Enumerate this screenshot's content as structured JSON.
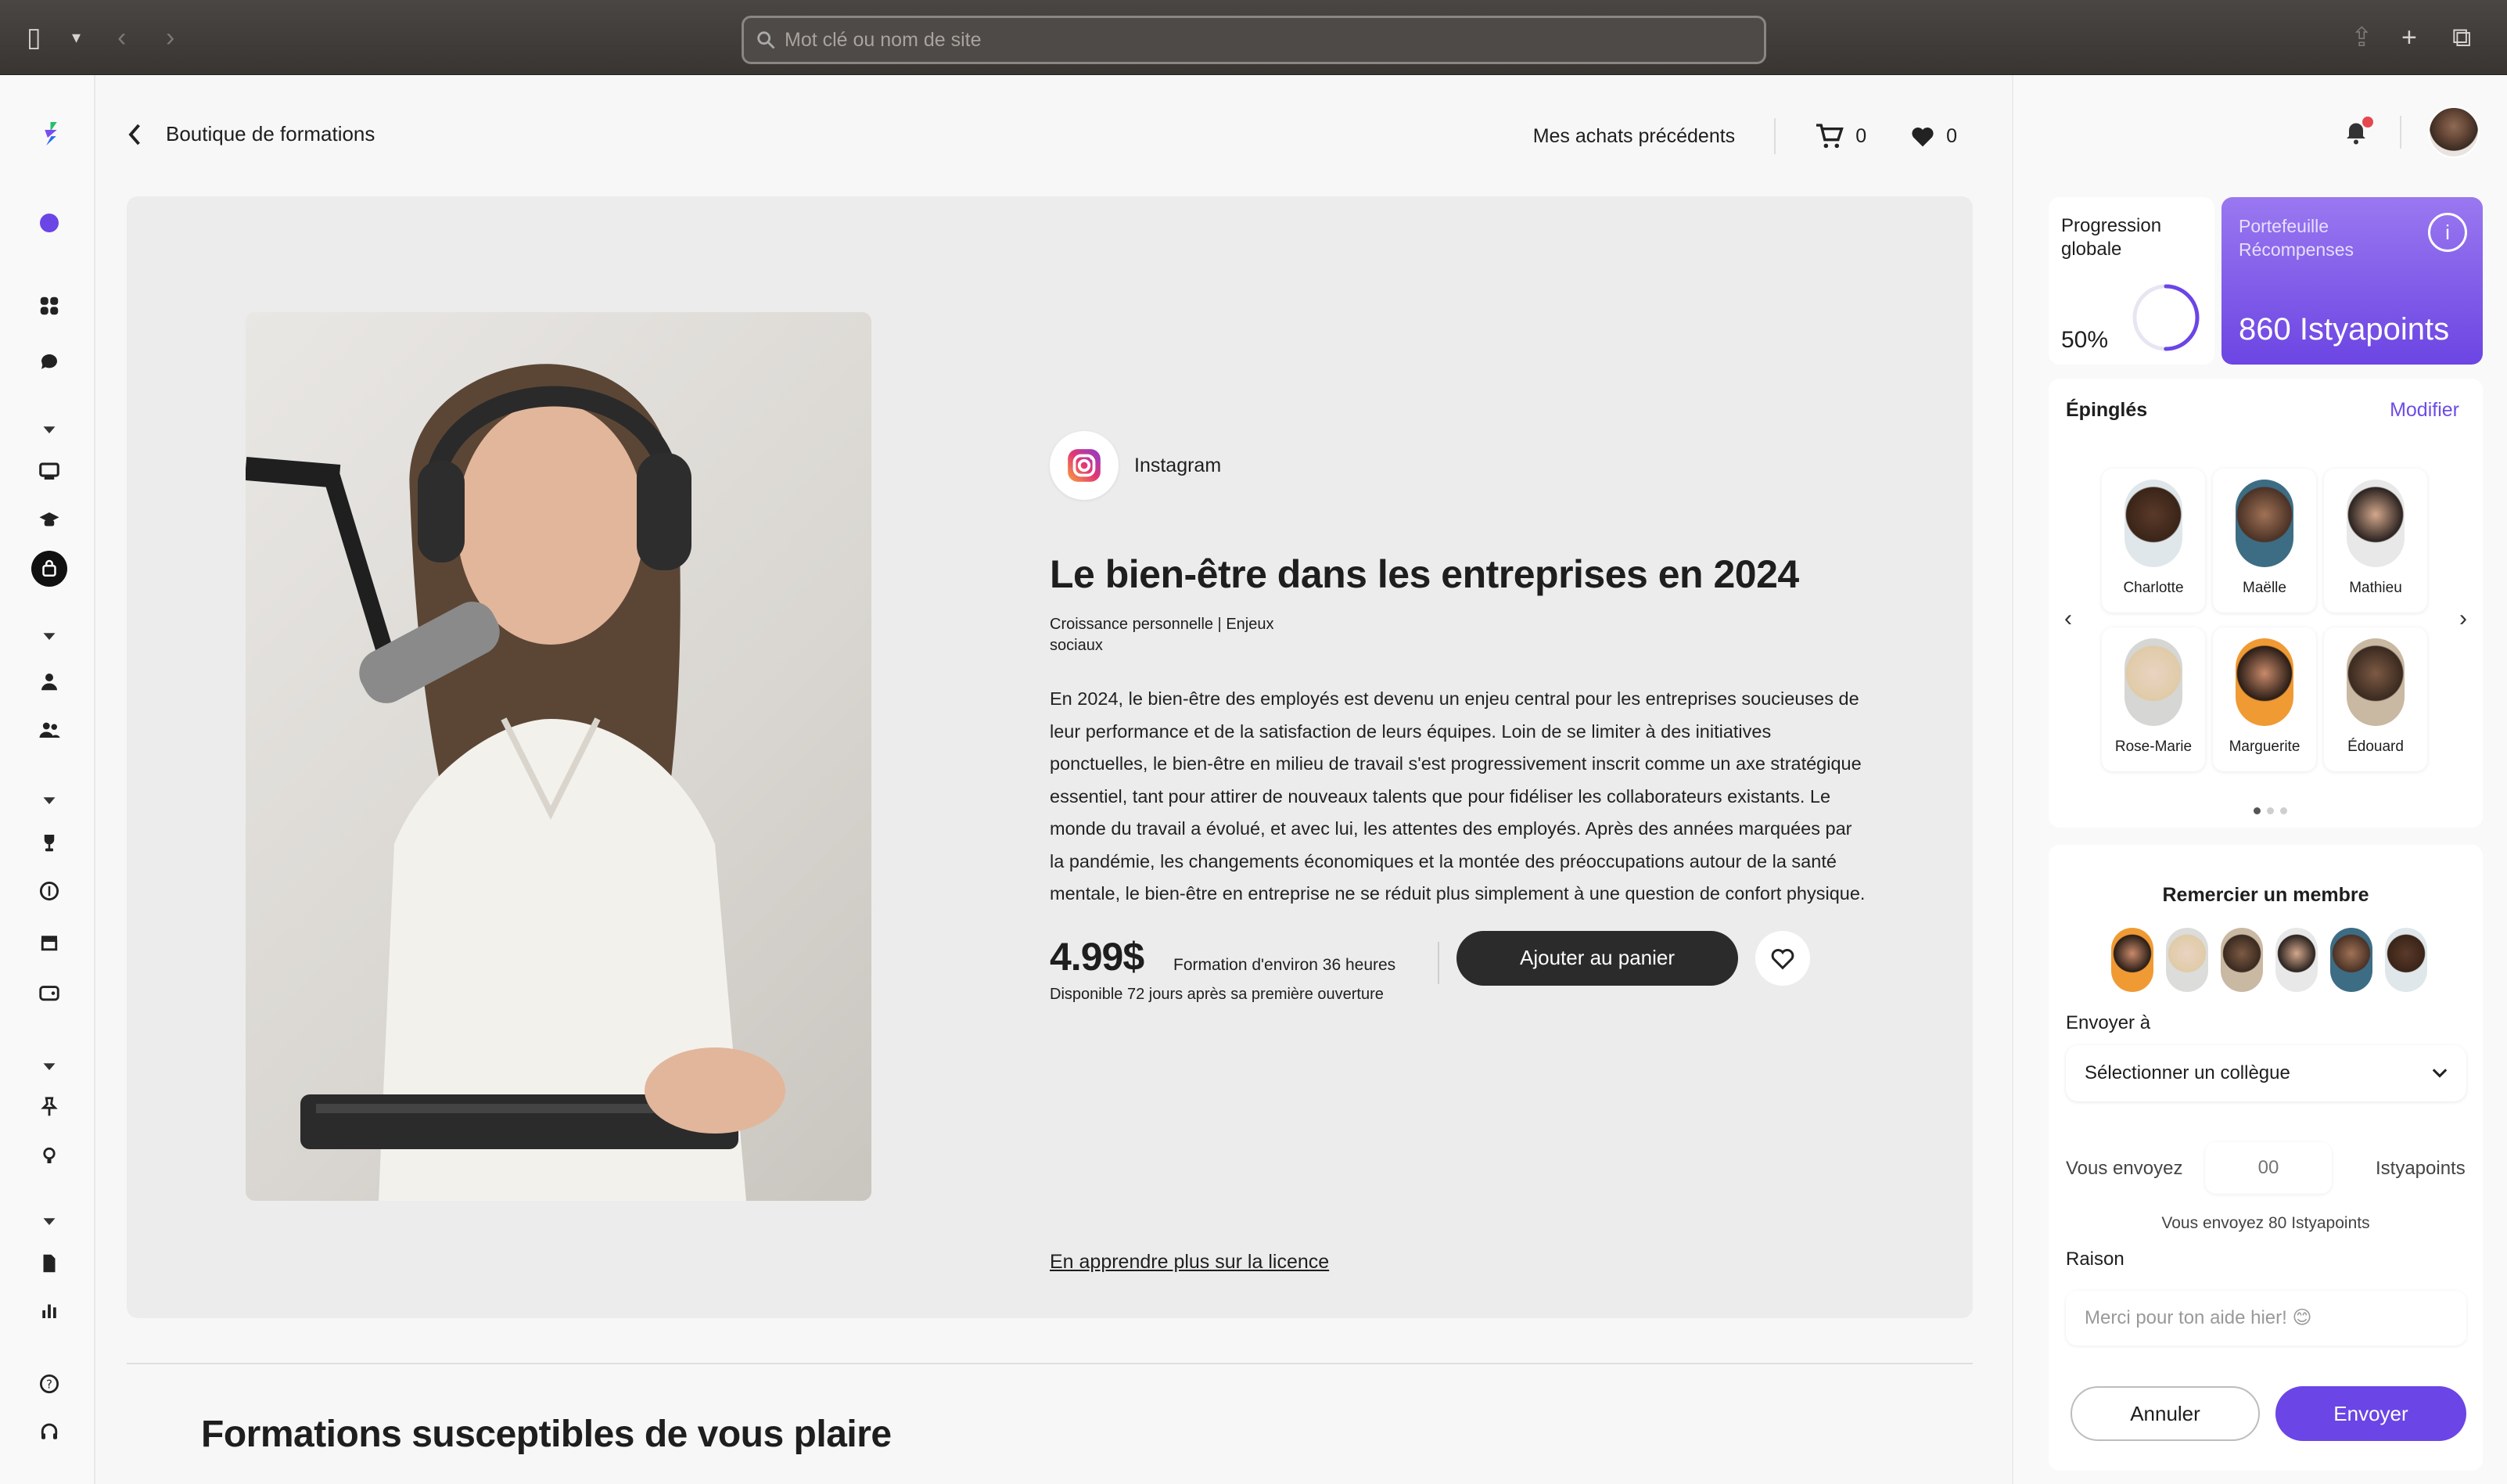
{
  "browser": {
    "search_placeholder": "Mot clé ou nom de site"
  },
  "header": {
    "back_label": "Boutique de formations",
    "previous_purchases": "Mes achats précédents",
    "cart_count": "0",
    "favorites_count": "0"
  },
  "product": {
    "provider": "Instagram",
    "title": "Le bien-être dans les entreprises en 2024",
    "categories": "Croissance personnelle | Enjeux sociaux",
    "description": "En 2024, le bien-être des employés est devenu un enjeu central pour les entreprises soucieuses de leur performance et de la satisfaction de leurs équipes. Loin de se limiter à des initiatives ponctuelles, le bien-être en milieu de travail s'est progressivement inscrit comme un axe stratégique essentiel, tant pour attirer de nouveaux talents que pour fidéliser les collaborateurs existants. Le monde du travail a évolué, et avec lui, les attentes des employés. Après des années marquées par la pandémie, les changements économiques et la montée des préoccupations autour de la santé mentale, le bien-être en entreprise ne se réduit plus simplement à une question de confort physique.",
    "price": "4.99$",
    "duration": "Formation d'environ 36 heures",
    "availability": "Disponible 72 jours après sa première ouverture",
    "add_to_cart": "Ajouter au panier",
    "license_link": "En apprendre plus sur la licence"
  },
  "recommendations": {
    "title": "Formations susceptibles de vous plaire"
  },
  "progress": {
    "label": "Progression globale",
    "value": "50%",
    "fraction": 0.5
  },
  "wallet": {
    "label": "Portefeuille Récompenses",
    "amount": "860 Istyapoints"
  },
  "pinned": {
    "title": "Épinglés",
    "edit": "Modifier",
    "people": [
      {
        "name": "Charlotte"
      },
      {
        "name": "Maëlle"
      },
      {
        "name": "Mathieu"
      },
      {
        "name": "Rose-Marie"
      },
      {
        "name": "Marguerite"
      },
      {
        "name": "Édouard"
      }
    ]
  },
  "thank": {
    "title": "Remercier un membre",
    "send_to_label": "Envoyer à",
    "select_placeholder": "Sélectionner un collègue",
    "you_send": "Vous envoyez",
    "amount_placeholder": "00",
    "unit": "Istyapoints",
    "summary": "Vous envoyez 80 Istyapoints",
    "reason_label": "Raison",
    "reason_placeholder": "Merci pour ton aide hier! 😊",
    "cancel": "Annuler",
    "send": "Envoyer"
  },
  "colors": {
    "accent": "#6b45e6",
    "dark_button": "#2b2b2b",
    "notification": "#e5484d"
  }
}
